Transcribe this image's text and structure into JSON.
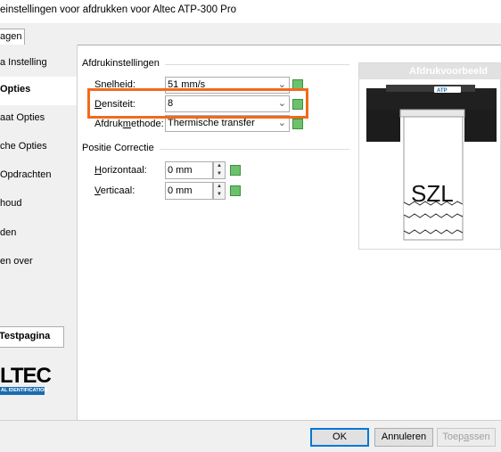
{
  "window": {
    "title": "einstellingen voor afdrukken voor Altec ATP-300 Pro"
  },
  "tabs": [
    {
      "label": "agen"
    }
  ],
  "sidebar": {
    "items": [
      {
        "label": "a Instelling"
      },
      {
        "label": "Opties",
        "active": true
      },
      {
        "label": "aat Opties"
      },
      {
        "label": "che Opties"
      },
      {
        "label": "Opdrachten"
      },
      {
        "label": "houd"
      },
      {
        "label": "den"
      },
      {
        "label": "en over"
      }
    ],
    "test_button": "Testpagina",
    "logo": {
      "text": "LTEC",
      "tagline": "AL IDENTIFICATION"
    }
  },
  "print_settings": {
    "group_title": "Afdrukinstellingen",
    "speed": {
      "label_pre": "S",
      "label_ul": "n",
      "label_post": "elheid:",
      "value": "51 mm/s"
    },
    "density": {
      "label_pre": "",
      "label_ul": "D",
      "label_post": "ensiteit:",
      "value": "8"
    },
    "method": {
      "label_pre": "Afdruk",
      "label_ul": "m",
      "label_post": "ethode:",
      "value": "Thermische transfer"
    }
  },
  "position": {
    "group_title": "Positie Correctie",
    "horizontal": {
      "label_pre": "",
      "label_ul": "H",
      "label_post": "orizontaal:",
      "value": "0 mm"
    },
    "vertical": {
      "label_pre": "",
      "label_ul": "V",
      "label_post": "erticaal:",
      "value": "0 mm"
    }
  },
  "preview": {
    "title": "Afdrukvoorbeeld",
    "printer_badge": "ATP",
    "sample_text": "SZL"
  },
  "footer": {
    "ok": "OK",
    "cancel": "Annuleren",
    "apply_pre": "Toep",
    "apply_ul": "a",
    "apply_post": "ssen"
  },
  "colors": {
    "highlight": "#f26a1b",
    "accent": "#0078d7",
    "indicator": "#6cc26c",
    "logo_blue": "#1b6db0"
  }
}
